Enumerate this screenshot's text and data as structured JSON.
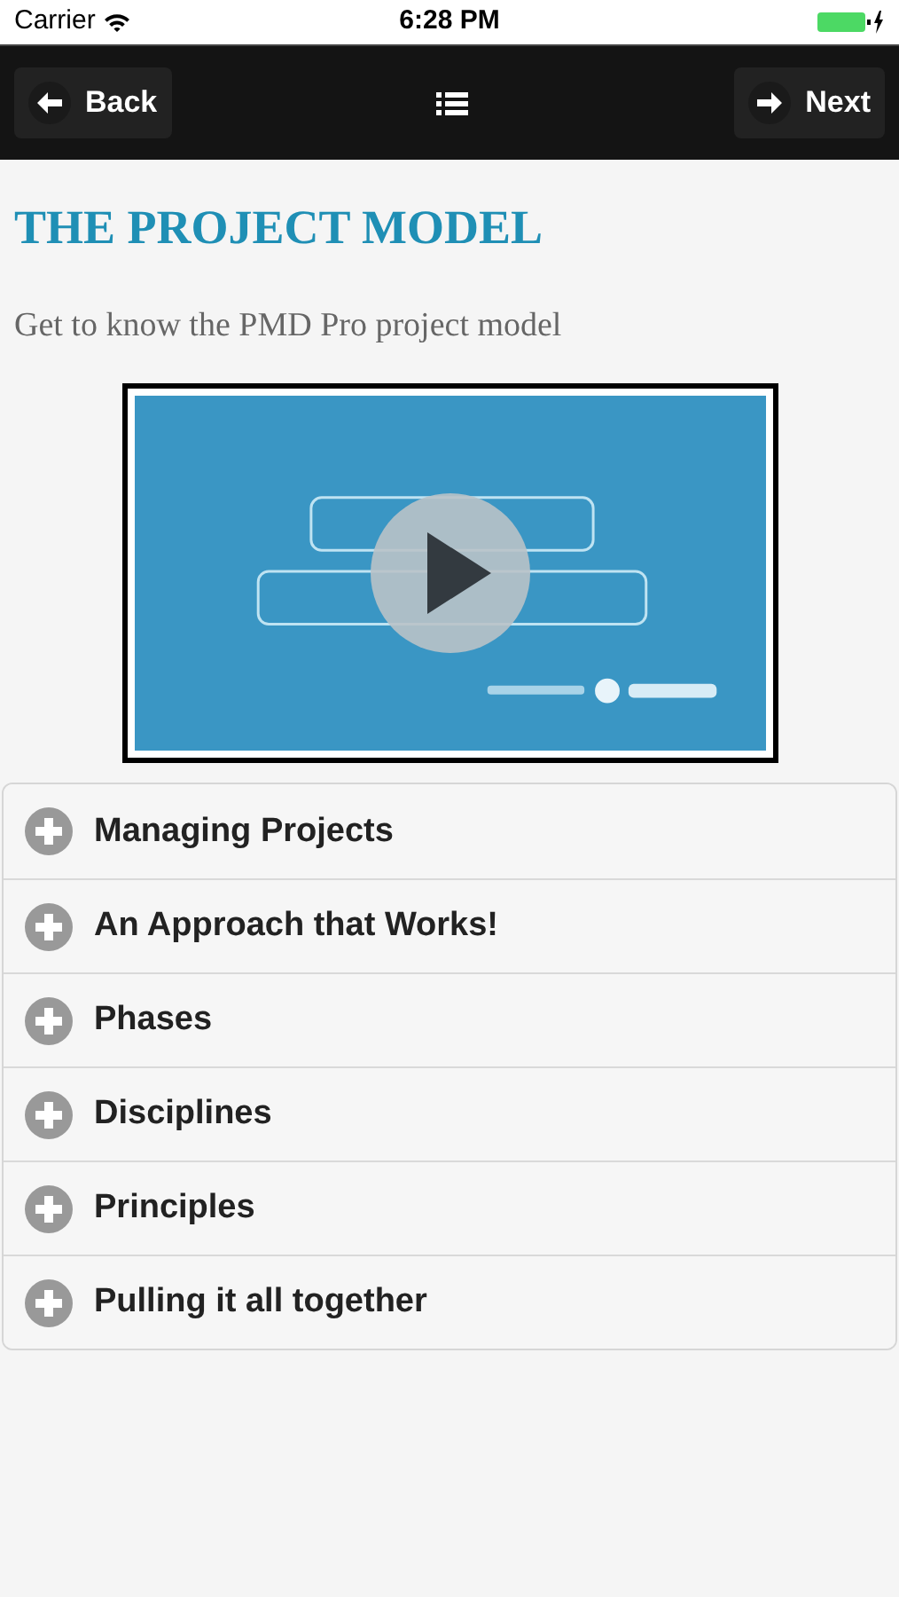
{
  "status_bar": {
    "carrier": "Carrier",
    "time": "6:28 PM"
  },
  "header": {
    "back": "Back",
    "next": "Next"
  },
  "title": "THE PROJECT MODEL",
  "subtitle": "Get to know the PMD Pro project model",
  "sections": [
    {
      "label": "Managing Projects",
      "expanded": false
    },
    {
      "label": "An Approach that Works!",
      "expanded": false
    },
    {
      "label": "Phases",
      "expanded": false
    },
    {
      "label": "Disciplines",
      "expanded": false
    },
    {
      "label": "Principles",
      "expanded": false
    },
    {
      "label": "Pulling it all together",
      "expanded": false
    }
  ]
}
